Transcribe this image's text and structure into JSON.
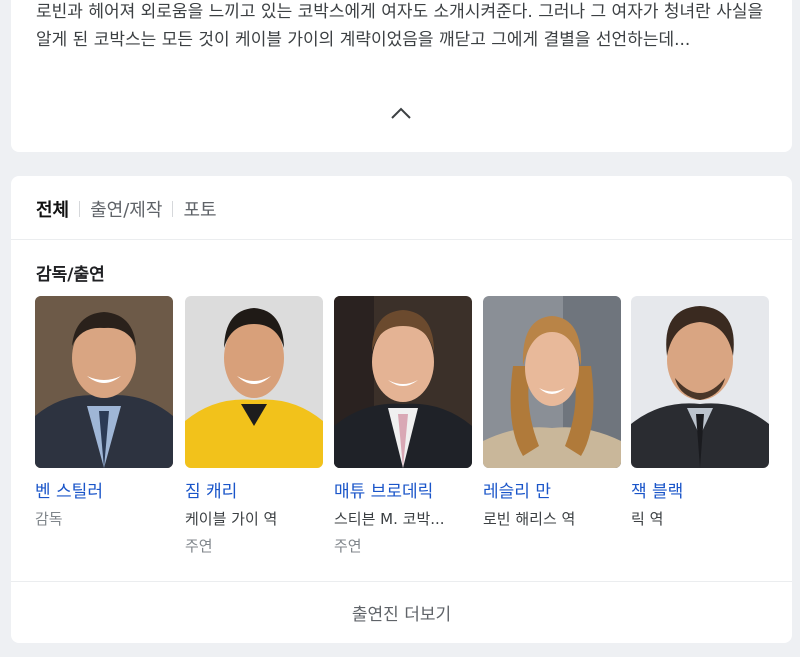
{
  "synopsis": {
    "text": "로빈과 헤어져 외로움을 느끼고 있는 코박스에게 여자도 소개시켜준다. 그러나 그 여자가 청녀란 사실을 알게 된 코박스는 모든 것이 케이블 가이의 계략이었음을 깨닫고 그에게 결별을 선언하는데..."
  },
  "tabs": [
    {
      "label": "전체"
    },
    {
      "label": "출연/제작"
    },
    {
      "label": "포토"
    }
  ],
  "section": {
    "title": "감독/출연"
  },
  "people": [
    {
      "name": "벤 스틸러",
      "role": "감독",
      "type": ""
    },
    {
      "name": "짐 캐리",
      "role": "케이블 가이 역",
      "type": "주연"
    },
    {
      "name": "매튜 브로데릭",
      "role": "스티븐 M. 코박...",
      "type": "주연"
    },
    {
      "name": "레슬리 만",
      "role": "로빈 해리스 역",
      "type": ""
    },
    {
      "name": "잭 블랙",
      "role": "릭 역",
      "type": ""
    }
  ],
  "more_button": {
    "label": "출연진 더보기"
  },
  "colors": {
    "link": "#1a55c9",
    "muted": "#80868b",
    "background": "#eef0f3"
  }
}
